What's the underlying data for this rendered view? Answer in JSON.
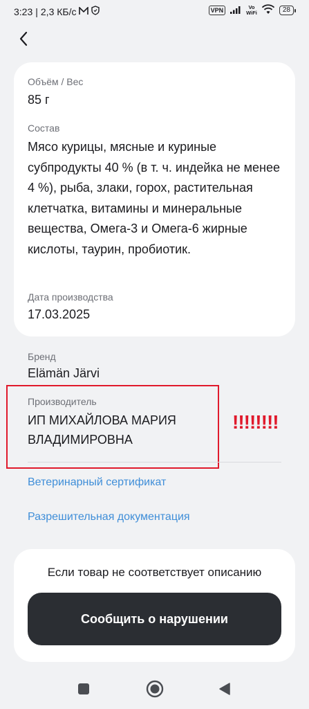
{
  "status_bar": {
    "time": "3:23",
    "separator": "|",
    "network_speed": "2,3 КБ/с",
    "vpn": "VPN",
    "volte_top": "Vo",
    "volte_bottom": "WiFi",
    "battery": "28"
  },
  "product": {
    "volume_label": "Объём / Вес",
    "volume_value": "85 г",
    "composition_label": "Состав",
    "composition_value": "Мясо курицы, мясные и куриные субпродукты 40 % (в т. ч. индейка не менее 4 %), рыба, злаки, горох, растительная клетчатка, витамины и минеральные вещества, Омега-3 и Омега-6 жирные кислоты, таурин, пробиотик.",
    "production_date_label": "Дата производства",
    "production_date_value": "17.03.2025",
    "brand_label": "Бренд",
    "brand_value": "Elämän Järvi",
    "manufacturer_label": "Производитель",
    "manufacturer_value": "ИП МИХАЙЛОВА МАРИЯ ВЛАДИМИРОВНА"
  },
  "annotation": {
    "exclamation": "!!!!!!!!",
    "color": "#e0192b"
  },
  "links": {
    "vet_certificate": "Ветеринарный сертификат",
    "permits": "Разрешительная документация",
    "color": "#3f8ed8"
  },
  "report": {
    "note": "Если товар не соответствует описанию",
    "button_label": "Сообщить о нарушении"
  },
  "icons": {
    "back": "chevron-left-icon",
    "nav_recent": "square-icon",
    "nav_home": "circle-icon",
    "nav_back": "triangle-left-icon"
  }
}
